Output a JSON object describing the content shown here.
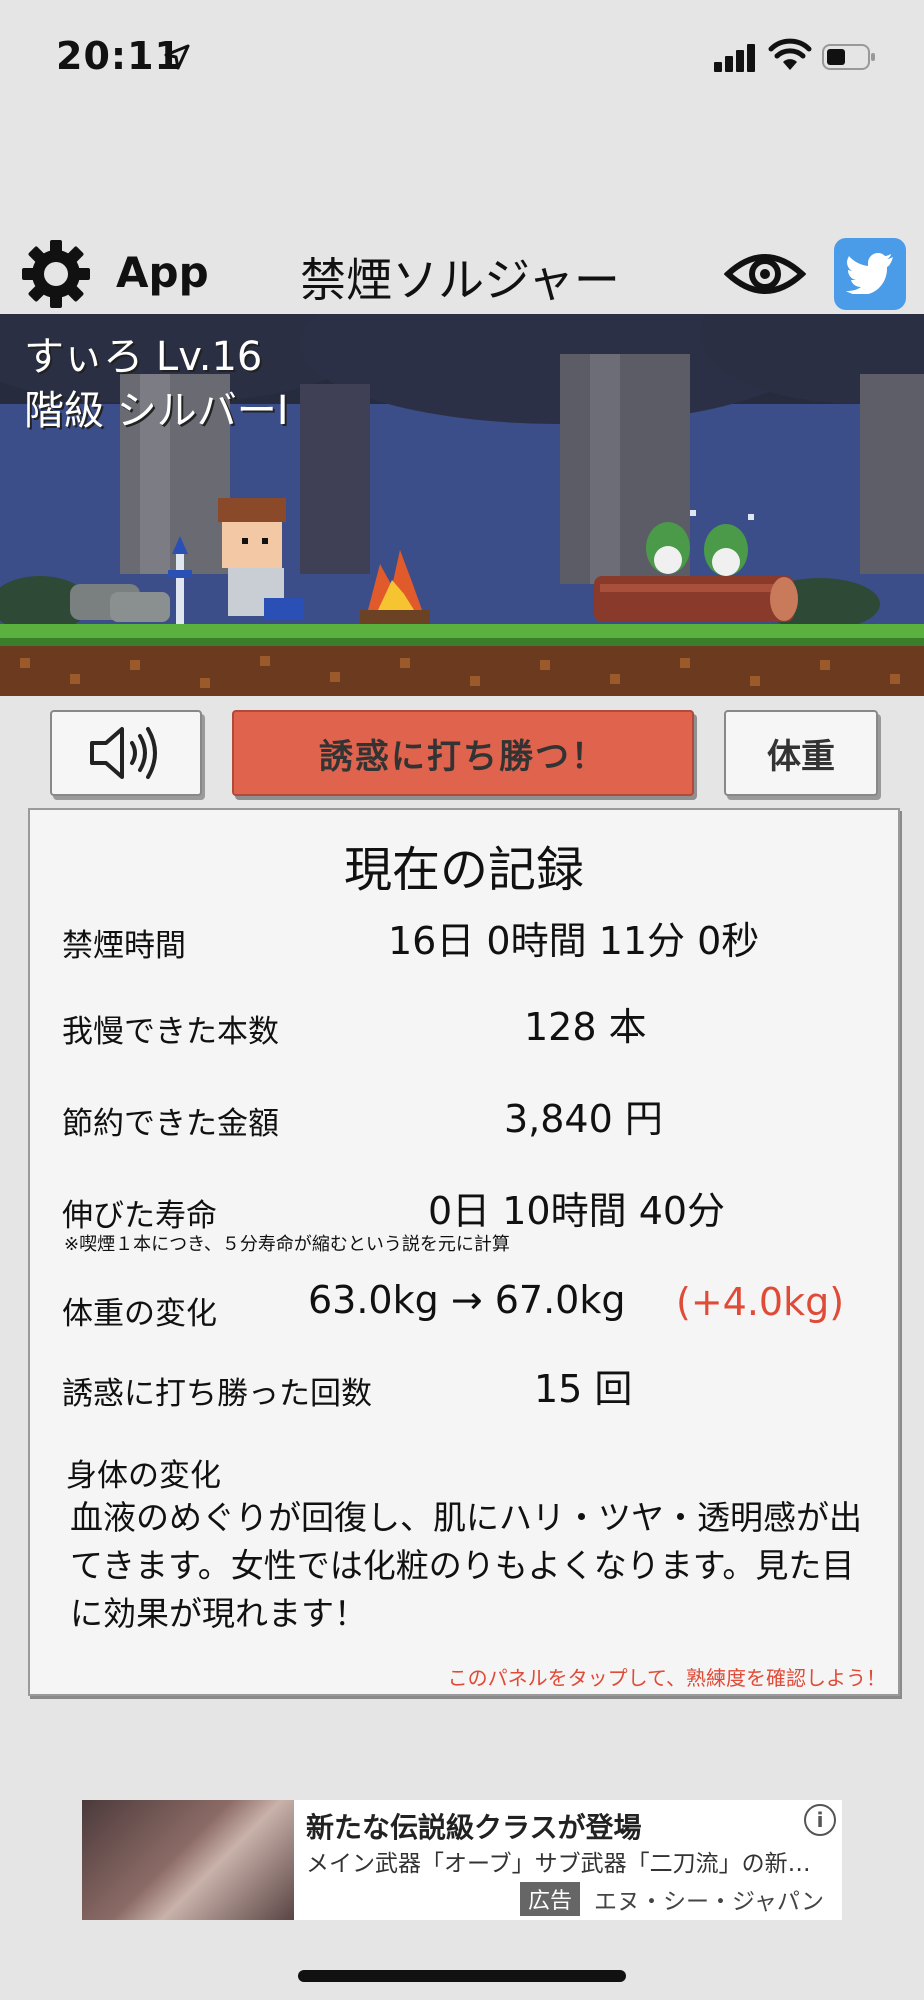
{
  "status_bar": {
    "time": "20:11"
  },
  "header": {
    "settings_label": "App",
    "title": "禁煙ソルジャー"
  },
  "scene": {
    "player_line": "すぃろ Lv.16",
    "rank_line": "階級 シルバーⅠ"
  },
  "buttons": {
    "resist": "誘惑に打ち勝つ！",
    "weight": "体重"
  },
  "record": {
    "title": "現在の記録",
    "rows": [
      {
        "label": "禁煙時間",
        "value": "16日 0時間 11分 0秒"
      },
      {
        "label": "我慢できた本数",
        "value": "128 本"
      },
      {
        "label": "節約できた金額",
        "value": "3,840 円"
      },
      {
        "label": "伸びた寿命",
        "value": "0日 10時間 40分"
      },
      {
        "label": "体重の変化",
        "value": "63.0kg → 67.0kg",
        "delta": "(+4.0kg)"
      },
      {
        "label": "誘惑に打ち勝った回数",
        "value": "15 回"
      }
    ],
    "lifespan_note": "※喫煙１本につき、５分寿命が縮むという説を元に計算",
    "body_change_label": "身体の変化",
    "body_change_text": "血液のめぐりが回復し、肌にハリ・ツヤ・透明感が出てきます。女性では化粧のりもよくなります。見た目に効果が現れます！",
    "tap_note": "このパネルをタップして、熟練度を確認しよう！"
  },
  "ad": {
    "title": "新たな伝説級クラスが登場",
    "description": "メイン武器「オーブ」サブ武器「二刀流」の新…",
    "badge": "広告",
    "advertiser": "エヌ・シー・ジャパン",
    "info_glyph": "i"
  },
  "colors": {
    "accent_red": "#e04b38",
    "button_red": "#e0634e",
    "twitter_blue": "#4a9be8",
    "grass": "#4fa33a",
    "dirt": "#6b3a1f"
  }
}
